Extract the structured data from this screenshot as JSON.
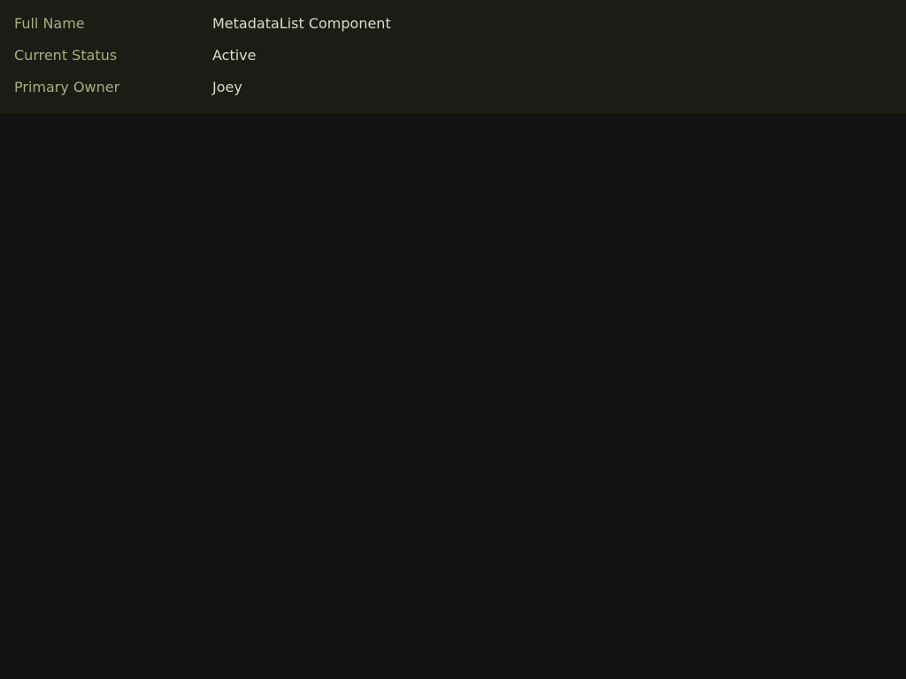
{
  "metadata_list": {
    "rows": [
      {
        "key": "Full Name",
        "value": "MetadataList Component"
      },
      {
        "key": "Current Status",
        "value": "Active"
      },
      {
        "key": "Primary Owner",
        "value": "Joey"
      }
    ]
  },
  "colors": {
    "panel_background": "#1c1c16",
    "page_background": "#131313",
    "key_text": "#a2b07c",
    "value_text": "#dcdcc8"
  }
}
